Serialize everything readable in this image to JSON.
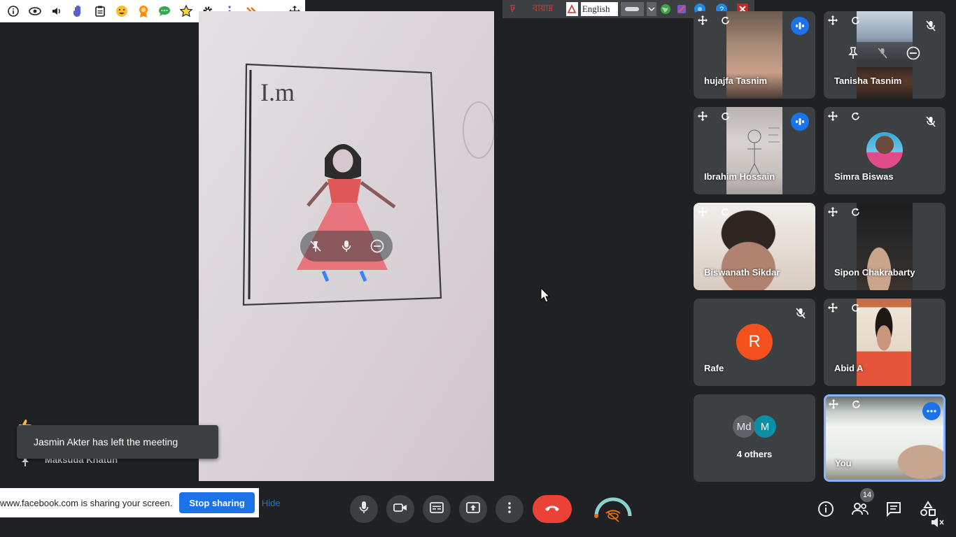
{
  "extension_toolbar": {
    "icons": [
      "info-icon",
      "eye-icon",
      "speaker-icon",
      "raise-hand-icon",
      "clipboard-icon",
      "emoji-icon",
      "award-icon",
      "chat-bubble-icon",
      "star-icon",
      "gear-icon",
      "more-vert-icon",
      "chevron-double-icon",
      "minimize-icon",
      "move-icon"
    ]
  },
  "language_bar": {
    "bengali_label": "বায়াম্ন",
    "language": "English"
  },
  "participants": [
    {
      "name": "hujajfa Tasnim",
      "state": "speaking"
    },
    {
      "name": "Tanisha Tasnim",
      "state": "muted"
    },
    {
      "name": "Ibrahim Hossain",
      "state": "speaking"
    },
    {
      "name": "Simra Biswas",
      "state": "muted"
    },
    {
      "name": "Biswanath Sikdar",
      "state": "video"
    },
    {
      "name": "Sipon Chakrabarty",
      "state": "video"
    },
    {
      "name": "Rafe",
      "state": "muted",
      "avatar_letter": "R",
      "avatar_color": "#f4511e"
    },
    {
      "name": "Abid A",
      "state": "video"
    },
    {
      "name": "4 others",
      "avatars": [
        "Md",
        "M"
      ]
    },
    {
      "name": "You",
      "state": "self"
    }
  ],
  "notifications": {
    "left_meeting": "Jasmin Akter has left the meeting",
    "background_name": "Maksuda Khatun"
  },
  "sharing_bar": {
    "message": "www.facebook.com is sharing your screen.",
    "stop_label": "Stop sharing",
    "hide_label": "Hide"
  },
  "drawing_text": "I.m",
  "people_count": "14",
  "colors": {
    "accent": "#1a73e8",
    "end_call": "#ea4335",
    "avatar_r": "#f4511e"
  }
}
